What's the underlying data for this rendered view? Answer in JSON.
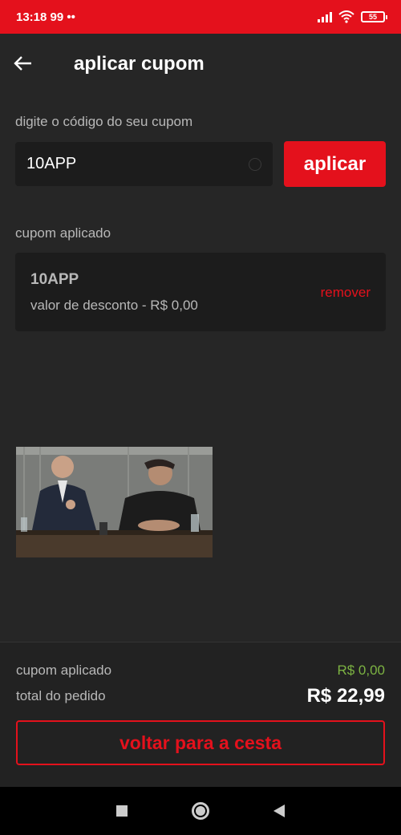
{
  "status_bar": {
    "time": "13:18 99 ••",
    "battery": "55"
  },
  "header": {
    "title": "aplicar cupom"
  },
  "coupon_form": {
    "label": "digite o código do seu cupom",
    "input_value": "10APP",
    "apply_label": "aplicar"
  },
  "applied_coupon": {
    "label": "cupom aplicado",
    "code": "10APP",
    "discount_text": "valor de desconto - R$ 0,00",
    "remove_label": "remover"
  },
  "footer": {
    "coupon_label": "cupom aplicado",
    "coupon_value": "R$ 0,00",
    "total_label": "total do pedido",
    "total_value": "R$ 22,99",
    "back_button_label": "voltar para a cesta"
  },
  "colors": {
    "brand_red": "#e4111c",
    "discount_green": "#7cb342",
    "background": "#262626"
  }
}
